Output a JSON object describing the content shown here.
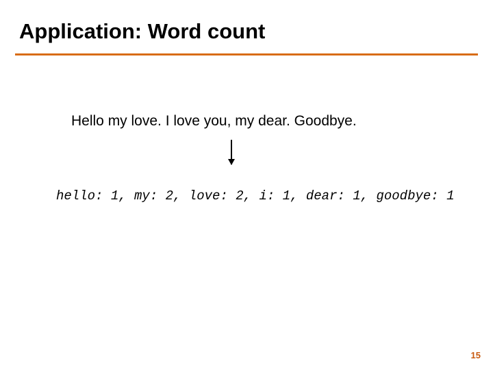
{
  "title": "Application: Word count",
  "input_sentence": "Hello my love. I love you, my dear. Goodbye.",
  "output_counts": "hello: 1, my: 2, love: 2, i: 1, dear: 1, goodbye: 1",
  "page_number": "15"
}
